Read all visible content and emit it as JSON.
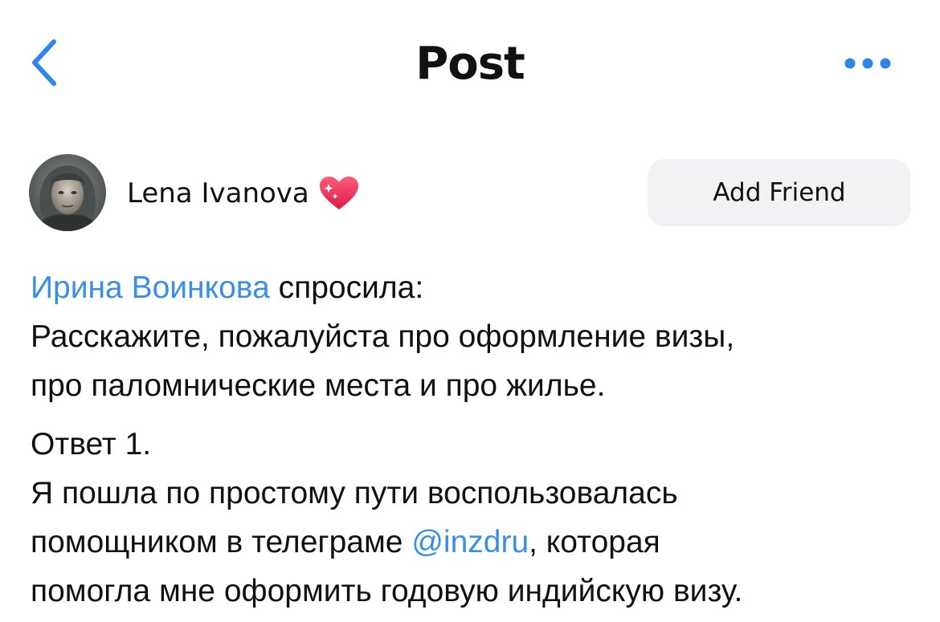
{
  "nav": {
    "title": "Post",
    "back_icon": "chevron-left-icon",
    "more_icon": "ellipsis-icon"
  },
  "author": {
    "name": "Lena Ivanova",
    "badge_icon": "sparkling-heart-icon",
    "add_friend_label": "Add Friend"
  },
  "post": {
    "asker": "Ирина Воинкова",
    "asked_suffix": " спросила:",
    "question_line1": "Расскажите, пожалуйста про оформление визы,",
    "question_line2": "про паломнические места и про жилье.",
    "answer_heading": "Ответ 1.",
    "answer_line1": "Я пошла по простому пути воспользовалась",
    "answer_line2_before": "помощником в телеграме ",
    "mention": "@inzdru",
    "answer_line2_after": ", которая",
    "answer_line3": "помогла мне оформить годовую индийскую визу."
  },
  "colors": {
    "accent": "#3a8ee6",
    "text": "#111111",
    "button_bg": "#f2f2f4",
    "heart": "#e8264f"
  }
}
